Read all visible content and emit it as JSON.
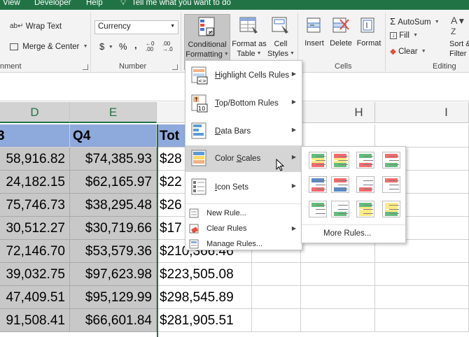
{
  "menubar": {
    "items": [
      "View",
      "Developer",
      "Help"
    ],
    "tell_me": "Tell me what you want to do"
  },
  "ribbon": {
    "alignment": {
      "wrap_text": "Wrap Text",
      "merge_center": "Merge & Center",
      "group_label": "nment"
    },
    "number": {
      "format_value": "Currency",
      "currency_symbol": "$",
      "percent_symbol": "%",
      "comma_symbol": ",",
      "group_label": "Number"
    },
    "styles": {
      "conditional_formatting": [
        "Conditional",
        "Formatting"
      ],
      "format_as_table": [
        "Format as",
        "Table"
      ],
      "cell_styles": [
        "Cell",
        "Styles"
      ]
    },
    "cells": {
      "insert": "Insert",
      "delete": "Delete",
      "format": "Format",
      "group_label": "Cells"
    },
    "editing": {
      "autosum": "AutoSum",
      "fill": "Fill",
      "clear": "Clear",
      "sort_filter": [
        "Sort &",
        "Filter"
      ],
      "group_label": "Editing"
    }
  },
  "grid": {
    "columns": [
      "D",
      "E",
      "",
      "H",
      "I"
    ],
    "header_row": [
      "3",
      "Q4",
      "Tot"
    ],
    "rows": [
      [
        "58,916.82",
        "$74,385.93",
        "$28"
      ],
      [
        "24,182.15",
        "$62,165.97",
        "$22"
      ],
      [
        "75,746.73",
        "$38,295.48",
        "$26"
      ],
      [
        "30,512.27",
        "$30,719.66",
        "$17"
      ],
      [
        "72,146.70",
        "$53,579.36",
        "$210,366.46"
      ],
      [
        "39,032.75",
        "$97,623.98",
        "$223,505.08"
      ],
      [
        "47,409.51",
        "$95,129.99",
        "$298,545.89"
      ],
      [
        "91,508.41",
        "$66,601.84",
        "$281,905.51"
      ]
    ]
  },
  "cf_menu": {
    "items": [
      {
        "label": "Highlight Cells Rules",
        "underline": "H",
        "icon": "highlight-cells-icon"
      },
      {
        "label": "Top/Bottom Rules",
        "underline": "T",
        "icon": "top-bottom-icon"
      },
      {
        "label": "Data Bars",
        "underline": "D",
        "icon": "data-bars-icon"
      },
      {
        "label": "Color Scales",
        "underline": "S",
        "icon": "color-scales-icon"
      },
      {
        "label": "Icon Sets",
        "underline": "I",
        "icon": "icon-sets-icon"
      }
    ],
    "small_items": [
      {
        "label": "New Rule...",
        "icon": "new-rule-icon"
      },
      {
        "label": "Clear Rules",
        "icon": "clear-rules-icon"
      },
      {
        "label": "Manage Rules...",
        "icon": "manage-rules-icon"
      }
    ],
    "top_bottom_badge": "10"
  },
  "color_scales": {
    "more_rules": "More Rules...",
    "swatches": [
      [
        "#63be7b",
        "#ffeb84",
        "#f8696b"
      ],
      [
        "#f8696b",
        "#ffeb84",
        "#63be7b"
      ],
      [
        "#63be7b",
        "#fcfcff",
        "#f8696b"
      ],
      [
        "#f8696b",
        "#fcfcff",
        "#63be7b"
      ],
      [
        "#5a8ac6",
        "#fcfcff",
        "#f8696b"
      ],
      [
        "#f8696b",
        "#fcfcff",
        "#5a8ac6"
      ],
      [
        "#fcfcff",
        "#fcfcff",
        "#f8696b"
      ],
      [
        "#f8696b",
        "#fcfcff",
        "#fcfcff"
      ],
      [
        "#63be7b",
        "#fcfcff",
        "#fcfcff"
      ],
      [
        "#fcfcff",
        "#fcfcff",
        "#63be7b"
      ],
      [
        "#63be7b",
        "#ffeb84",
        "#ffeb84"
      ],
      [
        "#ffeb84",
        "#ffeb84",
        "#63be7b"
      ]
    ]
  },
  "colors": {
    "excel_green": "#217346",
    "header_blue": "#8ea9db",
    "selection_gray": "#c8c8c8"
  }
}
